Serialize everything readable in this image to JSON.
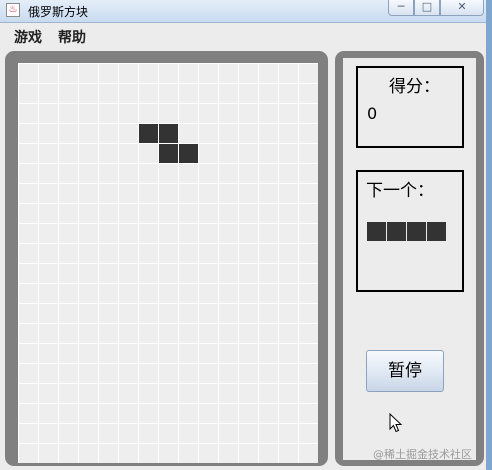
{
  "window": {
    "title": "俄罗斯方块",
    "app_icon": "java-icon",
    "app_icon_glyph": "♨",
    "controls": {
      "minimize": "─",
      "maximize": "□",
      "close": "✕"
    }
  },
  "menubar": {
    "items": [
      "游戏",
      "帮助"
    ]
  },
  "board": {
    "columns": 15,
    "rows": 20,
    "grid_line_color": "#ffffff",
    "cell_color": "#eeeeee",
    "block_color": "#333333",
    "active_piece": {
      "shape": "Z",
      "cells": [
        [
          6,
          3
        ],
        [
          7,
          3
        ],
        [
          7,
          4
        ],
        [
          8,
          4
        ]
      ]
    }
  },
  "score": {
    "label": "得分：",
    "value": "0"
  },
  "next_piece": {
    "label": "下一个：",
    "shape": "I",
    "block_count": 4
  },
  "controls": {
    "pause_label": "暂停"
  },
  "watermark": "@稀土掘金技术社区"
}
